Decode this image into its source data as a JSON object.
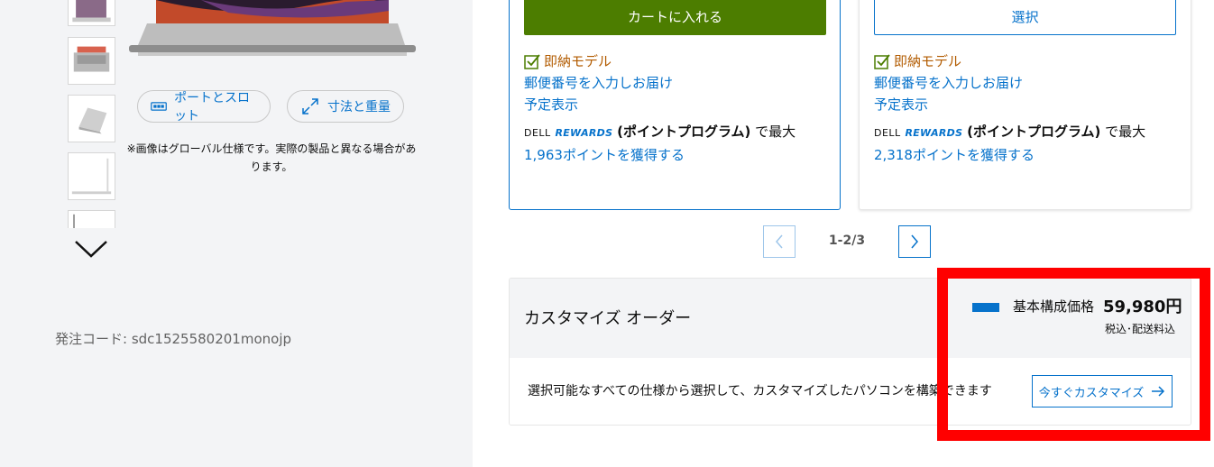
{
  "left": {
    "thumbnails": [
      "laptop-thumbnail-1",
      "laptop-thumbnail-2",
      "laptop-thumbnail-3",
      "laptop-thumbnail-4",
      "laptop-thumbnail-5"
    ],
    "ports_button_label": "ポートとスロット",
    "dimensions_button_label": "寸法と重量",
    "image_note": "※画像はグローバル仕様です。実際の製品と異なる場合があります。",
    "order_code": "発注コード: sdc1525580201monojp"
  },
  "cards": [
    {
      "button_label": "カートに入れる",
      "stock_label": "即納モデル",
      "postal_link": "郵便番号を入力しお届け",
      "schedule_link": "予定表示",
      "rewards_dell": "DELL",
      "rewards_brand": "REWARDS",
      "rewards_program": "(ポイントプログラム)",
      "rewards_text": " で最大 ",
      "rewards_points": "1,963ポイントを獲得する"
    },
    {
      "button_label": "選択",
      "stock_label": "即納モデル",
      "postal_link": "郵便番号を入力しお届け",
      "schedule_link": "予定表示",
      "rewards_dell": "DELL",
      "rewards_brand": "REWARDS",
      "rewards_program": "(ポイントプログラム)",
      "rewards_text": " で最大 ",
      "rewards_points": "2,318ポイントを獲得する"
    }
  ],
  "pager": {
    "count": "1-2/3"
  },
  "customize": {
    "title": "カスタマイズ オーダー",
    "price_label": "基本構成価格",
    "price_value": "59,980円",
    "price_note": "税込･配送料込",
    "description": "選択可能なすべての仕様から選択して、カスタマイズしたパソコンを構築できます",
    "button_label": "今すぐカスタマイズ"
  },
  "colors": {
    "accent": "#0672cb",
    "cart_green": "#4c7d00",
    "stock_orange": "#b25b00",
    "highlight": "#ff0000"
  }
}
